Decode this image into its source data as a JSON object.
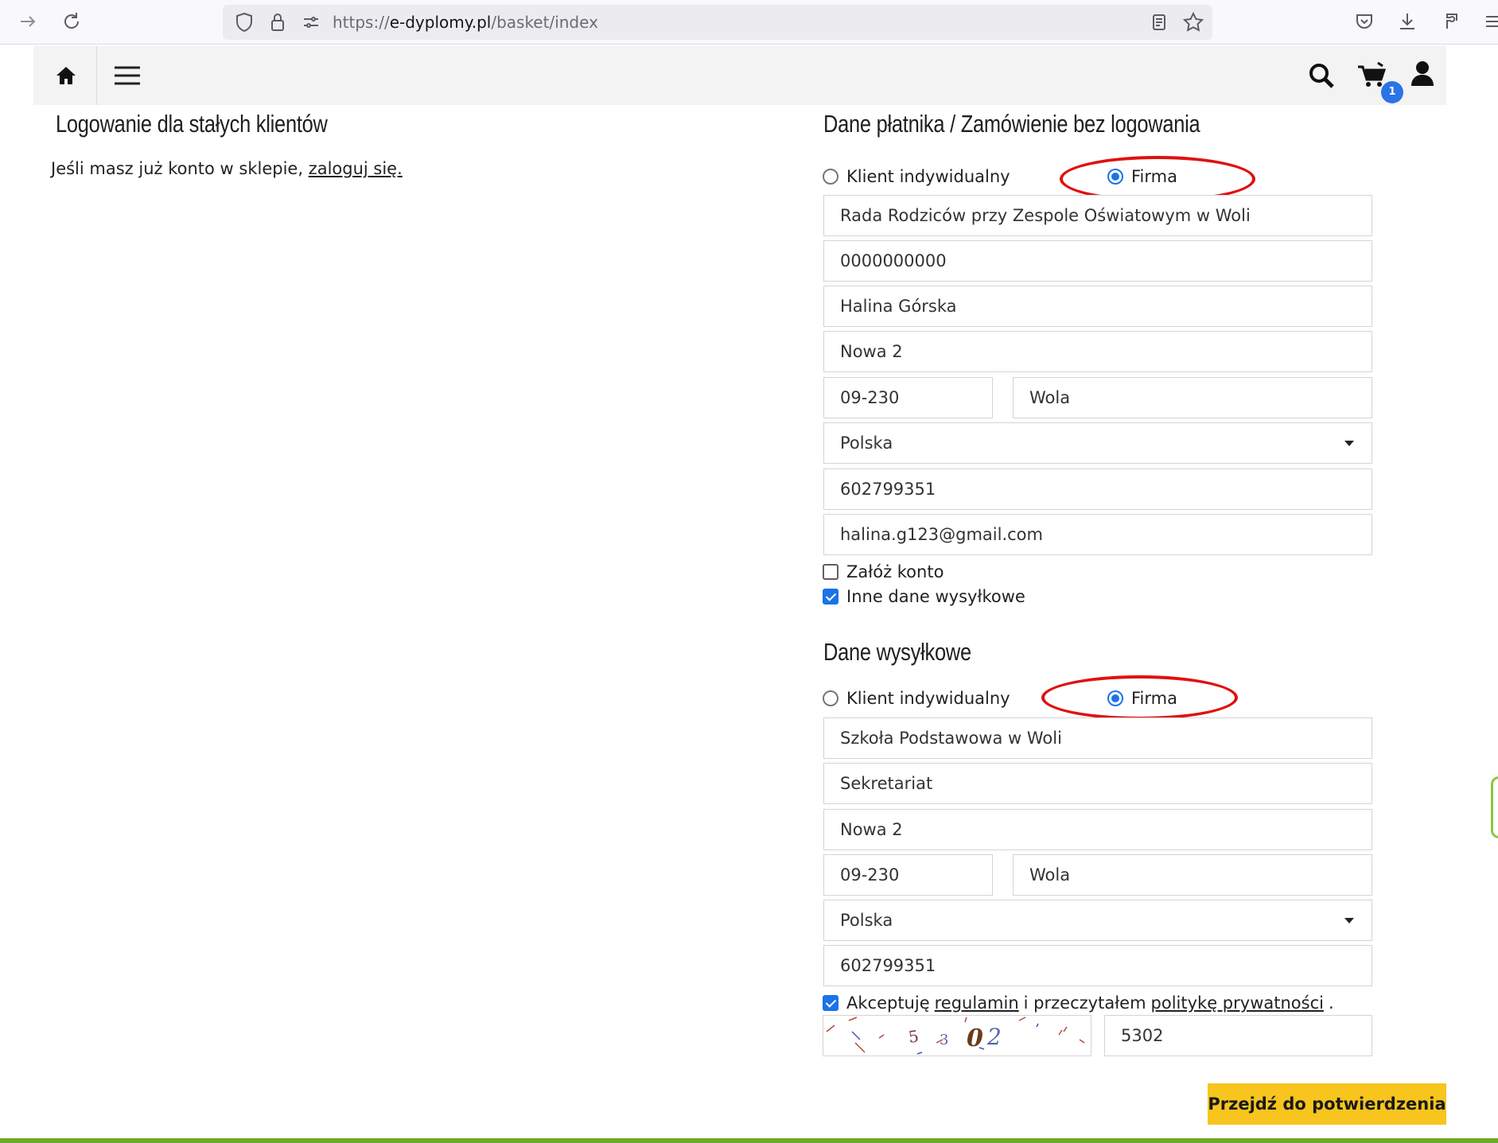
{
  "browser": {
    "url_prefix": "https://",
    "url_host": "e-dyplomy.pl",
    "url_path": "/basket/index"
  },
  "nav": {
    "cart_count": "1"
  },
  "login": {
    "heading": "Logowanie dla stałych klientów",
    "text": "Jeśli masz już konto w sklepie,",
    "link": "zaloguj się."
  },
  "payer": {
    "heading": "Dane płatnika / Zamówienie bez logowania",
    "radio_individual": "Klient indywidualny",
    "radio_company": "Firma",
    "company_name": "Rada Rodziców przy  Zespole Oświatowym w Woli",
    "nip": "0000000000",
    "person": "Halina Górska",
    "street": "Nowa 2",
    "postcode": "09-230",
    "city": "Wola",
    "country": "Polska",
    "phone": "602799351",
    "email": "halina.g123@gmail.com",
    "create_account": "Załóż konto",
    "other_shipping": "Inne dane wysyłkowe"
  },
  "shipping": {
    "heading": "Dane wysyłkowe",
    "radio_individual": "Klient indywidualny",
    "radio_company": "Firma",
    "company_name": "Szkoła Podstawowa w Woli",
    "department": "Sekretariat",
    "street": "Nowa 2",
    "postcode": "09-230",
    "city": "Wola",
    "country": "Polska",
    "phone": "602799351"
  },
  "terms": {
    "text_before": "Akceptuję",
    "link_terms": "regulamin",
    "text_middle": "i przeczytałem",
    "link_privacy": "politykę prywatności",
    "text_after": "."
  },
  "captcha": {
    "image_text": "53 02",
    "input_value": "5302"
  },
  "submit_label": "Przejdź do potwierdzenia",
  "colors": {
    "accent_blue": "#1a73e8",
    "button_yellow": "#f7c51e",
    "highlight_red": "#e01010",
    "footer_green": "#6cab2c"
  }
}
